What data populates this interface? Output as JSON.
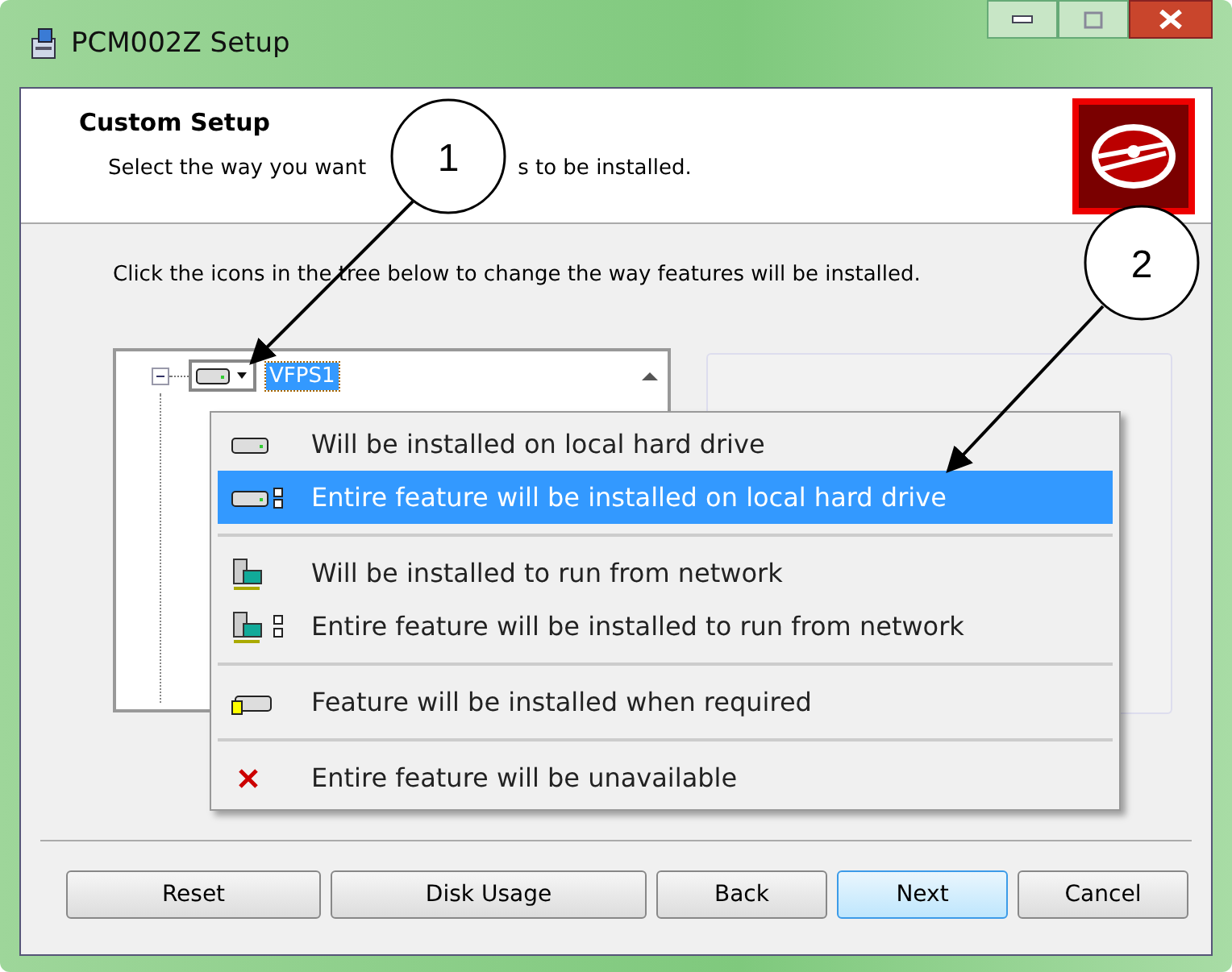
{
  "window": {
    "title": "PCM002Z Setup"
  },
  "header": {
    "title": "Custom Setup",
    "subtitle_parts": [
      "Select the way you want",
      "s to be installed."
    ]
  },
  "instruction": "Click the icons in the tree below to change the way features will be installed.",
  "tree": {
    "items": [
      {
        "label": "VFPS1",
        "expanded": true,
        "selected": true
      }
    ]
  },
  "menu": {
    "groups": [
      [
        {
          "kind": "hdd",
          "label": "Will be installed on local hard drive",
          "selected": false
        },
        {
          "kind": "hdd-entire",
          "label": "Entire feature will be installed on local hard drive",
          "selected": true
        }
      ],
      [
        {
          "kind": "network",
          "label": "Will be installed to run from network",
          "selected": false
        },
        {
          "kind": "network-entire",
          "label": "Entire feature will be installed to run from network",
          "selected": false
        }
      ],
      [
        {
          "kind": "required",
          "label": "Feature will be installed when required",
          "selected": false
        }
      ],
      [
        {
          "kind": "unavailable",
          "label": "Entire feature will be unavailable",
          "selected": false
        }
      ]
    ]
  },
  "callouts": [
    "1",
    "2"
  ],
  "buttons": [
    {
      "label": "Reset",
      "default": false
    },
    {
      "label": "Disk Usage",
      "default": false
    },
    {
      "label": "Back",
      "default": false
    },
    {
      "label": "Next",
      "default": true
    },
    {
      "label": "Cancel",
      "default": false
    }
  ]
}
